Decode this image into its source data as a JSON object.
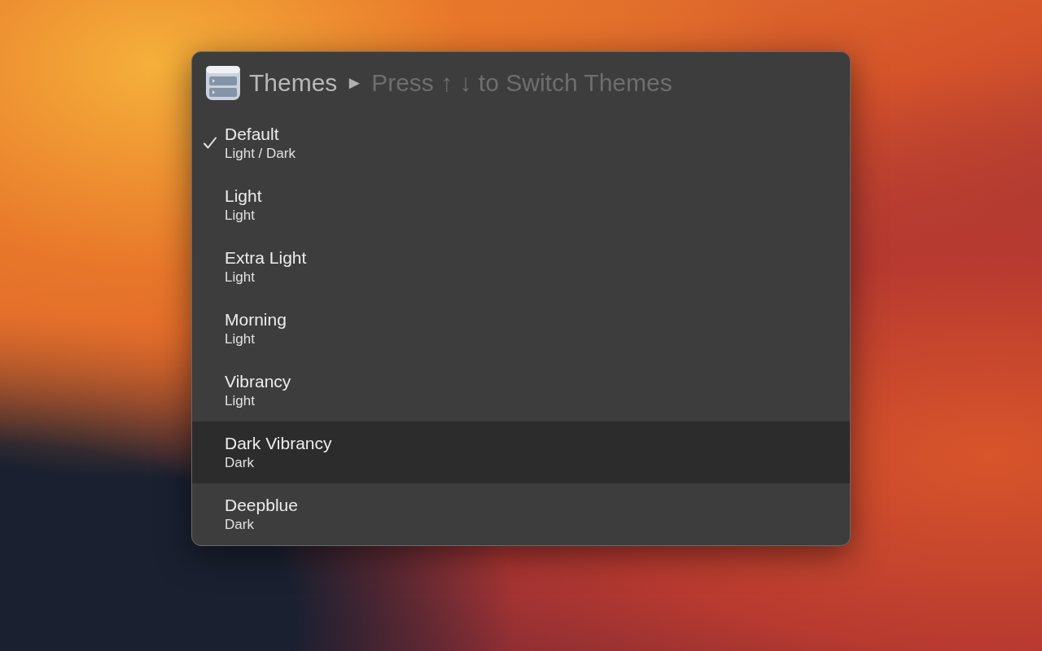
{
  "header": {
    "title": "Themes",
    "separator": "►",
    "hint": "Press ↑ ↓ to Switch Themes"
  },
  "themes": [
    {
      "name": "Default",
      "mode": "Light / Dark",
      "checked": true,
      "selected": false
    },
    {
      "name": "Light",
      "mode": "Light",
      "checked": false,
      "selected": false
    },
    {
      "name": "Extra Light",
      "mode": "Light",
      "checked": false,
      "selected": false
    },
    {
      "name": "Morning",
      "mode": "Light",
      "checked": false,
      "selected": false
    },
    {
      "name": "Vibrancy",
      "mode": "Light",
      "checked": false,
      "selected": false
    },
    {
      "name": "Dark Vibrancy",
      "mode": "Dark",
      "checked": false,
      "selected": true
    },
    {
      "name": "Deepblue",
      "mode": "Dark",
      "checked": false,
      "selected": false
    }
  ]
}
